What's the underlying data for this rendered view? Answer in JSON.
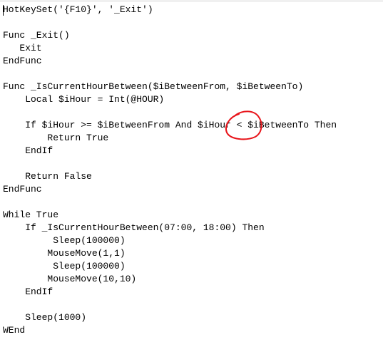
{
  "editor": {
    "lines": [
      "HotKeySet('{F10}', '_Exit')",
      "",
      "Func _Exit()",
      "   Exit",
      "EndFunc",
      "",
      "Func _IsCurrentHourBetween($iBetweenFrom, $iBetweenTo)",
      "    Local $iHour = Int(@HOUR)",
      "",
      "    If $iHour >= $iBetweenFrom And $iHour < $iBetweenTo Then",
      "        Return True",
      "    EndIf",
      "",
      "    Return False",
      "EndFunc",
      "",
      "While True",
      "    If _IsCurrentHourBetween(07:00, 18:00) Then",
      "         Sleep(100000)",
      "        MouseMove(1,1)",
      "         Sleep(100000)",
      "        MouseMove(10,10)",
      "    EndIf",
      "",
      "    Sleep(1000)",
      "WEnd"
    ]
  },
  "annotation": {
    "color": "#e8141a",
    "shape": "hand-drawn-circle"
  }
}
